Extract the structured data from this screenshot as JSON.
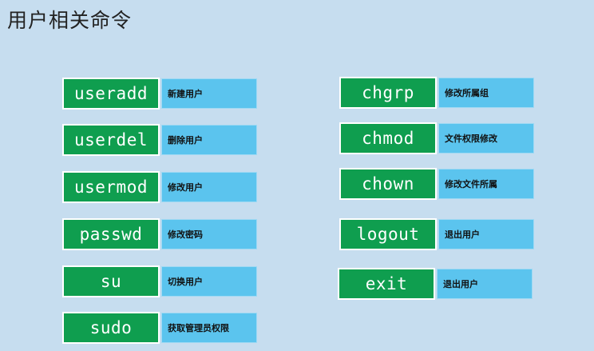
{
  "title": "用户相关命令",
  "left": [
    {
      "command": "useradd",
      "description": "新建用户"
    },
    {
      "command": "userdel",
      "description": "删除用户"
    },
    {
      "command": "usermod",
      "description": "修改用户"
    },
    {
      "command": "passwd",
      "description": "修改密码"
    },
    {
      "command": "su",
      "description": "切换用户"
    },
    {
      "command": "sudo",
      "description": "获取管理员权限"
    }
  ],
  "right": [
    {
      "command": "chgrp",
      "description": "修改所属组"
    },
    {
      "command": "chmod",
      "description": "文件权限修改"
    },
    {
      "command": "chown",
      "description": "修改文件所属"
    },
    {
      "command": "logout",
      "description": "退出用户"
    },
    {
      "command": "exit",
      "description": "退出用户"
    }
  ],
  "colors": {
    "background": "#c6ddef",
    "command_box": "#0f9e4f",
    "description_box": "#5bc4ee"
  }
}
